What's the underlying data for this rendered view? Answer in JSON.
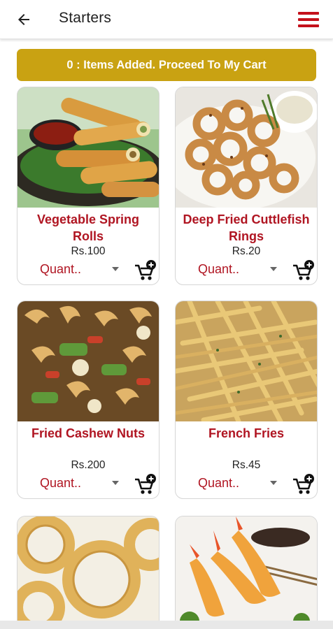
{
  "header": {
    "title": "Starters",
    "back_icon": "arrow-left-icon",
    "menu_icon": "hamburger-menu-icon",
    "accent_color": "#c4111b"
  },
  "cart_banner": {
    "text": "0 : Items Added. Proceed To My Cart",
    "color": "#c9a212"
  },
  "products": [
    {
      "name": "Vegetable Spring Rolls",
      "price": "Rs.100",
      "quantity_placeholder": "Quant..",
      "image": "spring-rolls-photo"
    },
    {
      "name": "Deep Fried Cuttlefish Rings",
      "price": "Rs.20",
      "quantity_placeholder": "Quant..",
      "image": "cuttlefish-rings-photo"
    },
    {
      "name": "Fried Cashew Nuts",
      "price": "Rs.200",
      "quantity_placeholder": "Quant..",
      "image": "cashew-nuts-photo"
    },
    {
      "name": "French Fries",
      "price": "Rs.45",
      "quantity_placeholder": "Quant..",
      "image": "french-fries-photo"
    },
    {
      "image": "onion-rings-photo"
    },
    {
      "image": "fried-prawns-photo"
    }
  ],
  "theme": {
    "name_color": "#b01522",
    "add_to_cart_icon": "cart-plus-icon"
  }
}
